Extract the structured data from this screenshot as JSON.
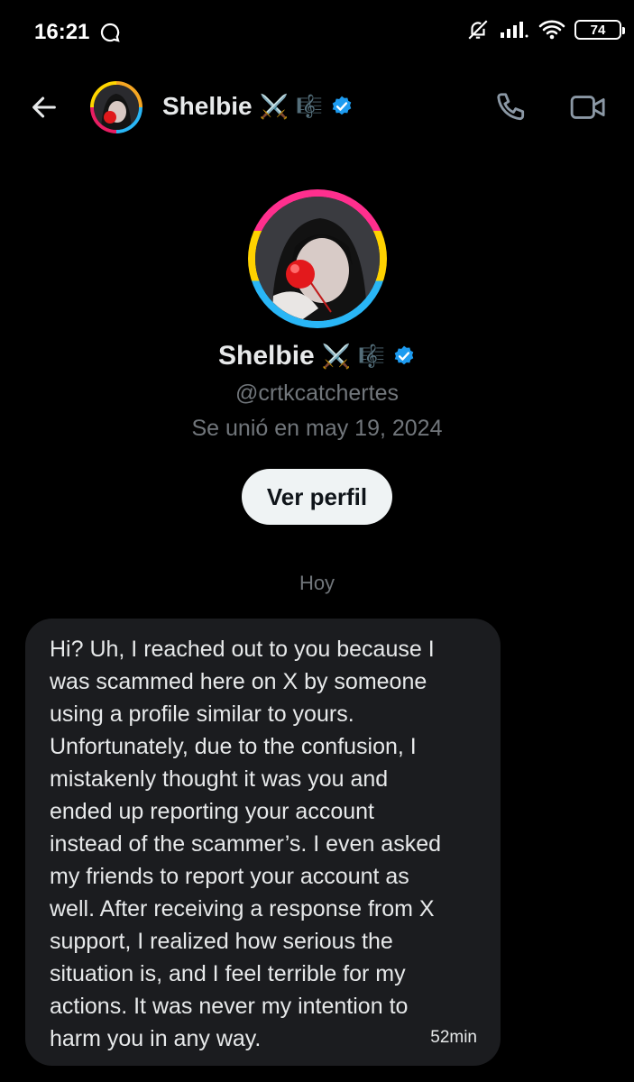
{
  "status_bar": {
    "time": "16:21",
    "battery": "74"
  },
  "header": {
    "name": "Shelbie",
    "name_emoji_swords": "⚔️",
    "name_emoji_music": "🎼",
    "verified": true,
    "icons": [
      "back-arrow-icon",
      "phone-icon",
      "video-camera-icon"
    ]
  },
  "profile": {
    "name": "Shelbie",
    "name_emoji_swords": "⚔️",
    "name_emoji_music": "🎼",
    "handle": "@crtkcatchertes",
    "joined": "Se unió en may 19, 2024",
    "view_profile_label": "Ver perfil"
  },
  "conversation": {
    "day_label": "Hoy",
    "messages": [
      {
        "text": "Hi? Uh, I reached out to you because I\nwas scammed here on X by someone\nusing a profile similar to yours.\nUnfortunately, due to the confusion, I\nmistakenly thought it was you and\nended up reporting your account\ninstead of the scammer’s. I even asked\nmy friends to report your account as\nwell. After receiving a response from X\nsupport, I realized how serious the\nsituation is, and I feel terrible for my\nactions. It was never my intention to\nharm you in any way.",
        "time": "52min"
      }
    ]
  },
  "colors": {
    "background": "#000000",
    "bubble": "#1b1c1f",
    "verified": "#1d9bf0",
    "muted_text": "#71767b"
  }
}
